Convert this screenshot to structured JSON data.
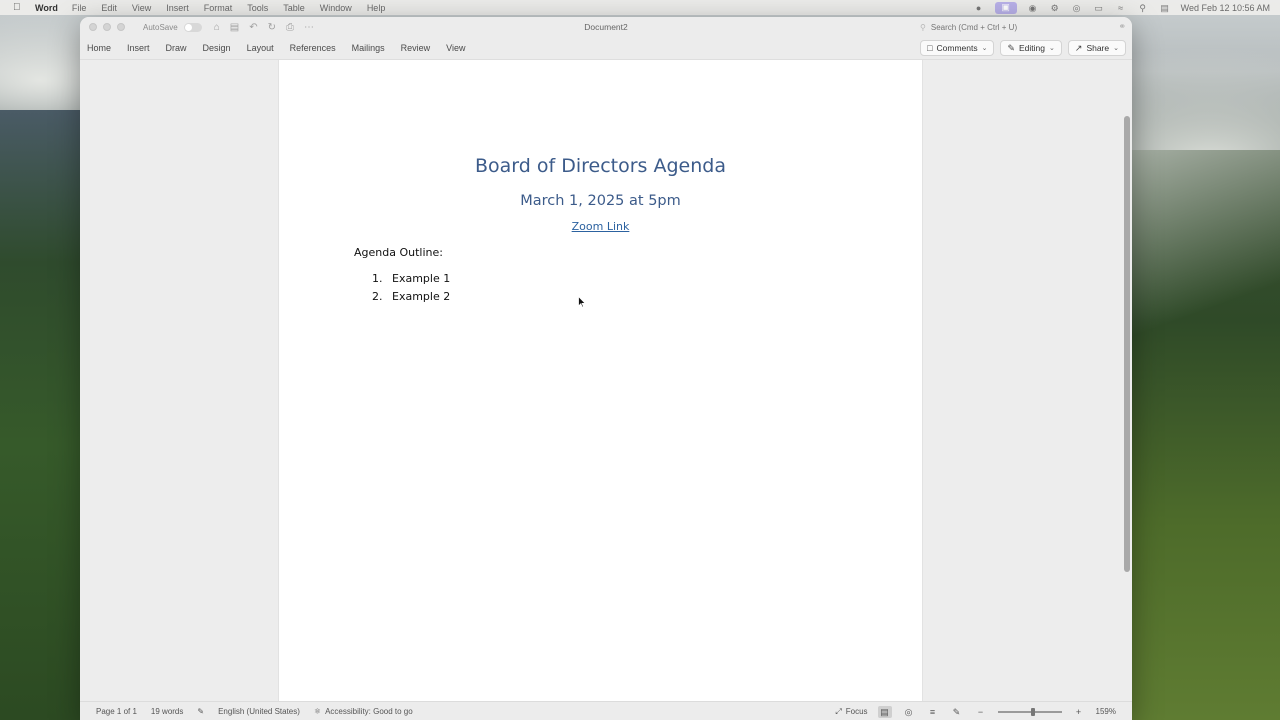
{
  "menubar": {
    "app_name": "Word",
    "items": [
      "File",
      "Edit",
      "View",
      "Insert",
      "Format",
      "Tools",
      "Table",
      "Window",
      "Help"
    ],
    "clock": "Wed Feb 12  10:56 AM"
  },
  "window": {
    "title": "Document2",
    "autosave_label": "AutoSave",
    "search_placeholder": "Search (Cmd + Ctrl + U)"
  },
  "ribbon": {
    "tabs": [
      "Home",
      "Insert",
      "Draw",
      "Design",
      "Layout",
      "References",
      "Mailings",
      "Review",
      "View"
    ],
    "comments_label": "Comments",
    "editing_label": "Editing",
    "share_label": "Share"
  },
  "document": {
    "title": "Board of Directors Agenda",
    "subtitle": "March 1, 2025 at 5pm",
    "link_text": "Zoom Link",
    "outline_label": "Agenda Outline:",
    "items": [
      {
        "num": "1.",
        "text": "Example 1"
      },
      {
        "num": "2.",
        "text": "Example 2"
      }
    ]
  },
  "statusbar": {
    "page": "Page 1 of 1",
    "words": "19 words",
    "language": "English (United States)",
    "accessibility": "Accessibility: Good to go",
    "focus": "Focus",
    "zoom": "159%"
  },
  "colors": {
    "heading": "#3c5b8a",
    "link": "#2c62a0"
  },
  "icons": {
    "comments": "speech-bubble-icon",
    "editing": "pencil-icon",
    "share": "share-icon"
  }
}
